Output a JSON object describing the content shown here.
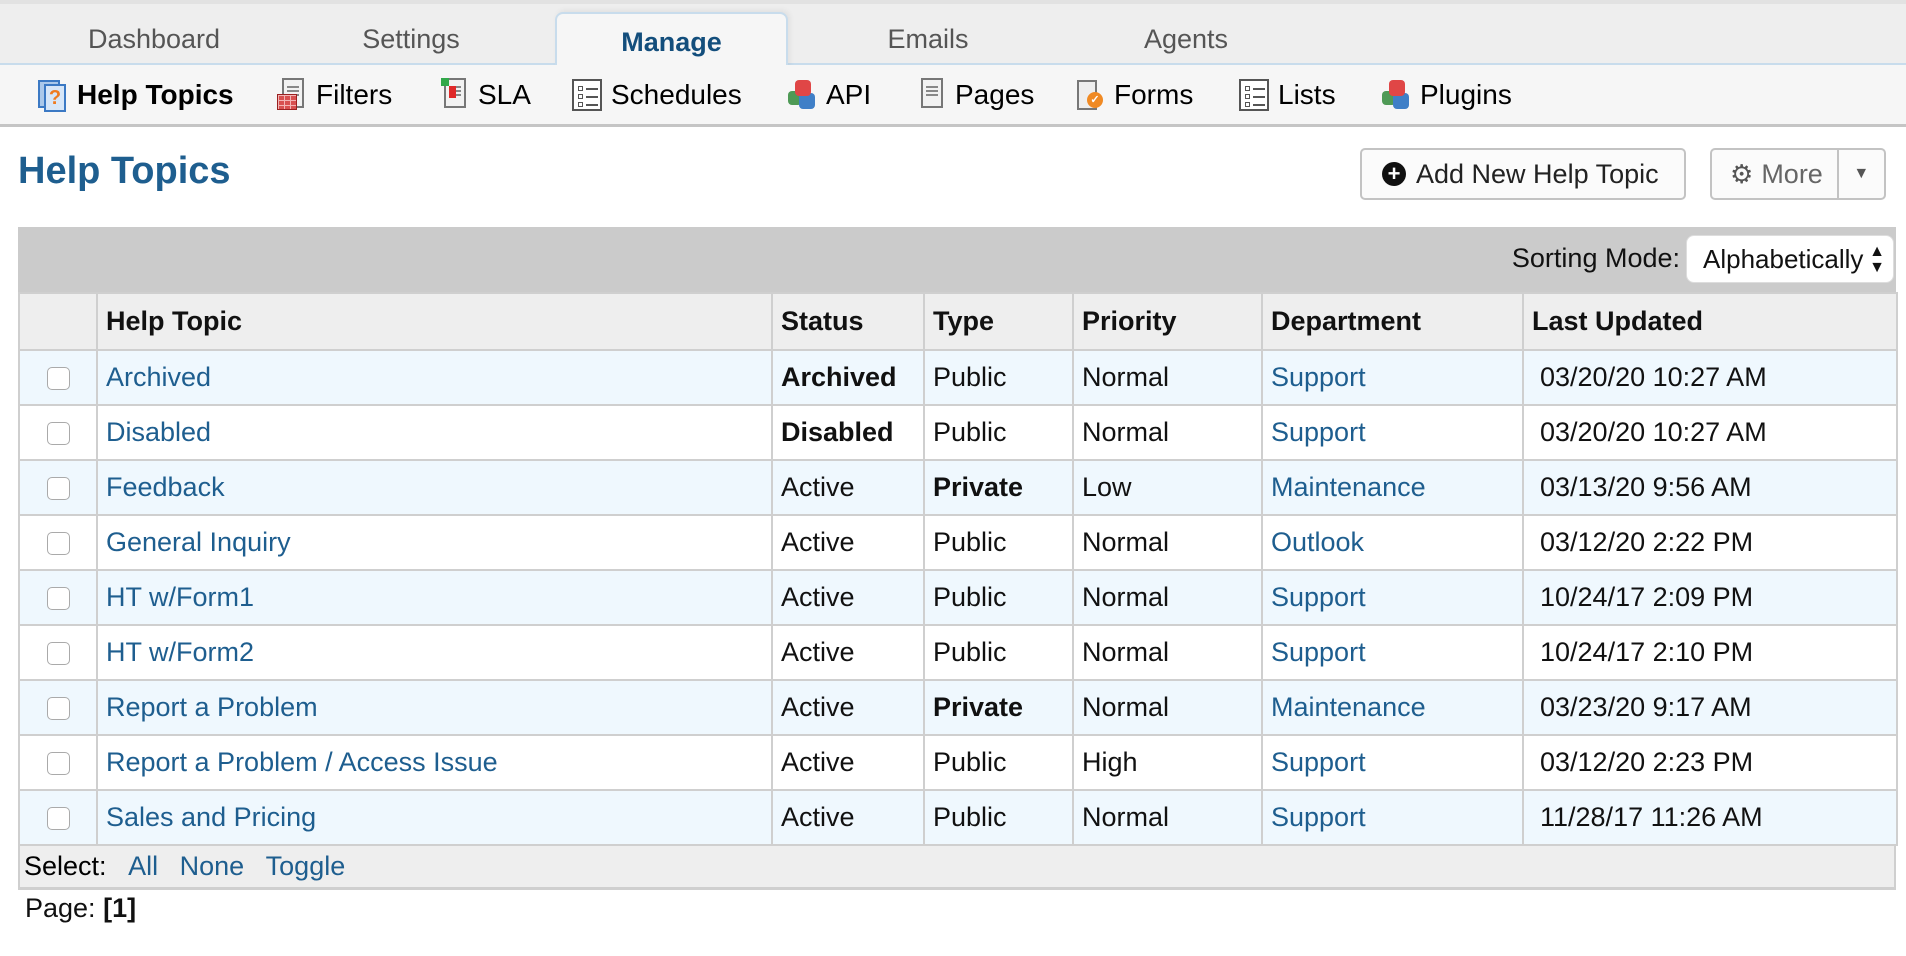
{
  "tabs": [
    {
      "label": "Dashboard",
      "active": false
    },
    {
      "label": "Settings",
      "active": false
    },
    {
      "label": "Manage",
      "active": true
    },
    {
      "label": "Emails",
      "active": false
    },
    {
      "label": "Agents",
      "active": false
    }
  ],
  "subnav": [
    {
      "label": "Help Topics",
      "icon": "help-topics-icon",
      "active": true
    },
    {
      "label": "Filters",
      "icon": "filters-icon"
    },
    {
      "label": "SLA",
      "icon": "sla-icon"
    },
    {
      "label": "Schedules",
      "icon": "schedules-icon"
    },
    {
      "label": "API",
      "icon": "api-icon"
    },
    {
      "label": "Pages",
      "icon": "pages-icon"
    },
    {
      "label": "Forms",
      "icon": "forms-icon"
    },
    {
      "label": "Lists",
      "icon": "lists-icon"
    },
    {
      "label": "Plugins",
      "icon": "plugins-icon"
    }
  ],
  "page": {
    "title": "Help Topics",
    "add_button": "Add New Help Topic",
    "more_button": "More"
  },
  "sorting": {
    "label": "Sorting Mode:",
    "value": "Alphabetically"
  },
  "table": {
    "columns": [
      "Help Topic",
      "Status",
      "Type",
      "Priority",
      "Department",
      "Last Updated"
    ],
    "rows": [
      {
        "topic": "Archived",
        "status": "Archived",
        "status_bold": true,
        "type": "Public",
        "type_bold": false,
        "priority": "Normal",
        "department": "Support",
        "updated": "03/20/20 10:27 AM"
      },
      {
        "topic": "Disabled",
        "status": "Disabled",
        "status_bold": true,
        "type": "Public",
        "type_bold": false,
        "priority": "Normal",
        "department": "Support",
        "updated": "03/20/20 10:27 AM"
      },
      {
        "topic": "Feedback",
        "status": "Active",
        "status_bold": false,
        "type": "Private",
        "type_bold": true,
        "priority": "Low",
        "department": "Maintenance",
        "updated": "03/13/20 9:56 AM"
      },
      {
        "topic": "General Inquiry",
        "status": "Active",
        "status_bold": false,
        "type": "Public",
        "type_bold": false,
        "priority": "Normal",
        "department": "Outlook",
        "updated": "03/12/20 2:22 PM"
      },
      {
        "topic": "HT w/Form1",
        "status": "Active",
        "status_bold": false,
        "type": "Public",
        "type_bold": false,
        "priority": "Normal",
        "department": "Support",
        "updated": "10/24/17 2:09 PM"
      },
      {
        "topic": "HT w/Form2",
        "status": "Active",
        "status_bold": false,
        "type": "Public",
        "type_bold": false,
        "priority": "Normal",
        "department": "Support",
        "updated": "10/24/17 2:10 PM"
      },
      {
        "topic": "Report a Problem",
        "status": "Active",
        "status_bold": false,
        "type": "Private",
        "type_bold": true,
        "priority": "Normal",
        "department": "Maintenance",
        "updated": "03/23/20 9:17 AM"
      },
      {
        "topic": "Report a Problem / Access Issue",
        "status": "Active",
        "status_bold": false,
        "type": "Public",
        "type_bold": false,
        "priority": "High",
        "department": "Support",
        "updated": "03/12/20 2:23 PM"
      },
      {
        "topic": "Sales and Pricing",
        "status": "Active",
        "status_bold": false,
        "type": "Public",
        "type_bold": false,
        "priority": "Normal",
        "department": "Support",
        "updated": "11/28/17 11:26 AM"
      }
    ]
  },
  "select": {
    "label": "Select:",
    "all": "All",
    "none": "None",
    "toggle": "Toggle"
  },
  "pager": {
    "label": "Page:",
    "current": "[1]"
  },
  "colors": {
    "accent": "#1e5e8f",
    "row_alt": "#eff8fe",
    "toolbar": "#cbcbcb"
  }
}
